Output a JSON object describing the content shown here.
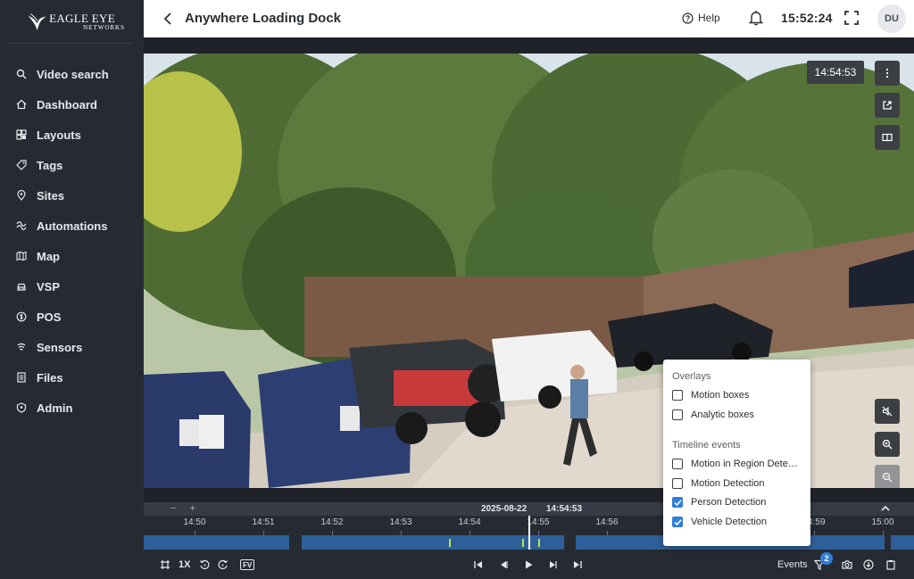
{
  "brand": {
    "line1": "EAGLE EYE",
    "line2": "NETWORKS"
  },
  "sidebar": {
    "items": [
      {
        "label": "Video search",
        "icon": "search-icon"
      },
      {
        "label": "Dashboard",
        "icon": "home-icon"
      },
      {
        "label": "Layouts",
        "icon": "layout-icon"
      },
      {
        "label": "Tags",
        "icon": "tag-icon"
      },
      {
        "label": "Sites",
        "icon": "pin-icon"
      },
      {
        "label": "Automations",
        "icon": "automation-icon"
      },
      {
        "label": "Map",
        "icon": "map-icon"
      },
      {
        "label": "VSP",
        "icon": "car-icon"
      },
      {
        "label": "POS",
        "icon": "pos-icon"
      },
      {
        "label": "Sensors",
        "icon": "sensor-icon"
      },
      {
        "label": "Files",
        "icon": "file-icon"
      },
      {
        "label": "Admin",
        "icon": "admin-icon"
      }
    ]
  },
  "header": {
    "title": "Anywhere Loading Dock",
    "help_label": "Help",
    "clock": "15:52:24",
    "avatar_initials": "DU"
  },
  "video": {
    "timestamp": "14:54:53"
  },
  "timeline": {
    "zoom_out": "−",
    "zoom_in": "+",
    "date": "2025-08-22",
    "time": "14:54:53",
    "ticks": [
      "14:50",
      "14:51",
      "14:52",
      "14:53",
      "14:54",
      "14:55",
      "14:56",
      "14:59",
      "15:00"
    ]
  },
  "controls": {
    "speed": "1X",
    "fv_label": "FV",
    "events_label": "Events",
    "events_count": "2"
  },
  "popup": {
    "overlays_title": "Overlays",
    "overlays": [
      {
        "label": "Motion boxes",
        "checked": false
      },
      {
        "label": "Analytic boxes",
        "checked": false
      }
    ],
    "events_title": "Timeline events",
    "events": [
      {
        "label": "Motion in Region Detection",
        "checked": false
      },
      {
        "label": "Motion Detection",
        "checked": false
      },
      {
        "label": "Person Detection",
        "checked": true
      },
      {
        "label": "Vehicle Detection",
        "checked": true
      }
    ]
  },
  "colors": {
    "sidebar_bg": "#262b33",
    "accent": "#2f7fd8",
    "timeline_segment": "#2f5f9a",
    "event_marker": "#b7e34a"
  }
}
